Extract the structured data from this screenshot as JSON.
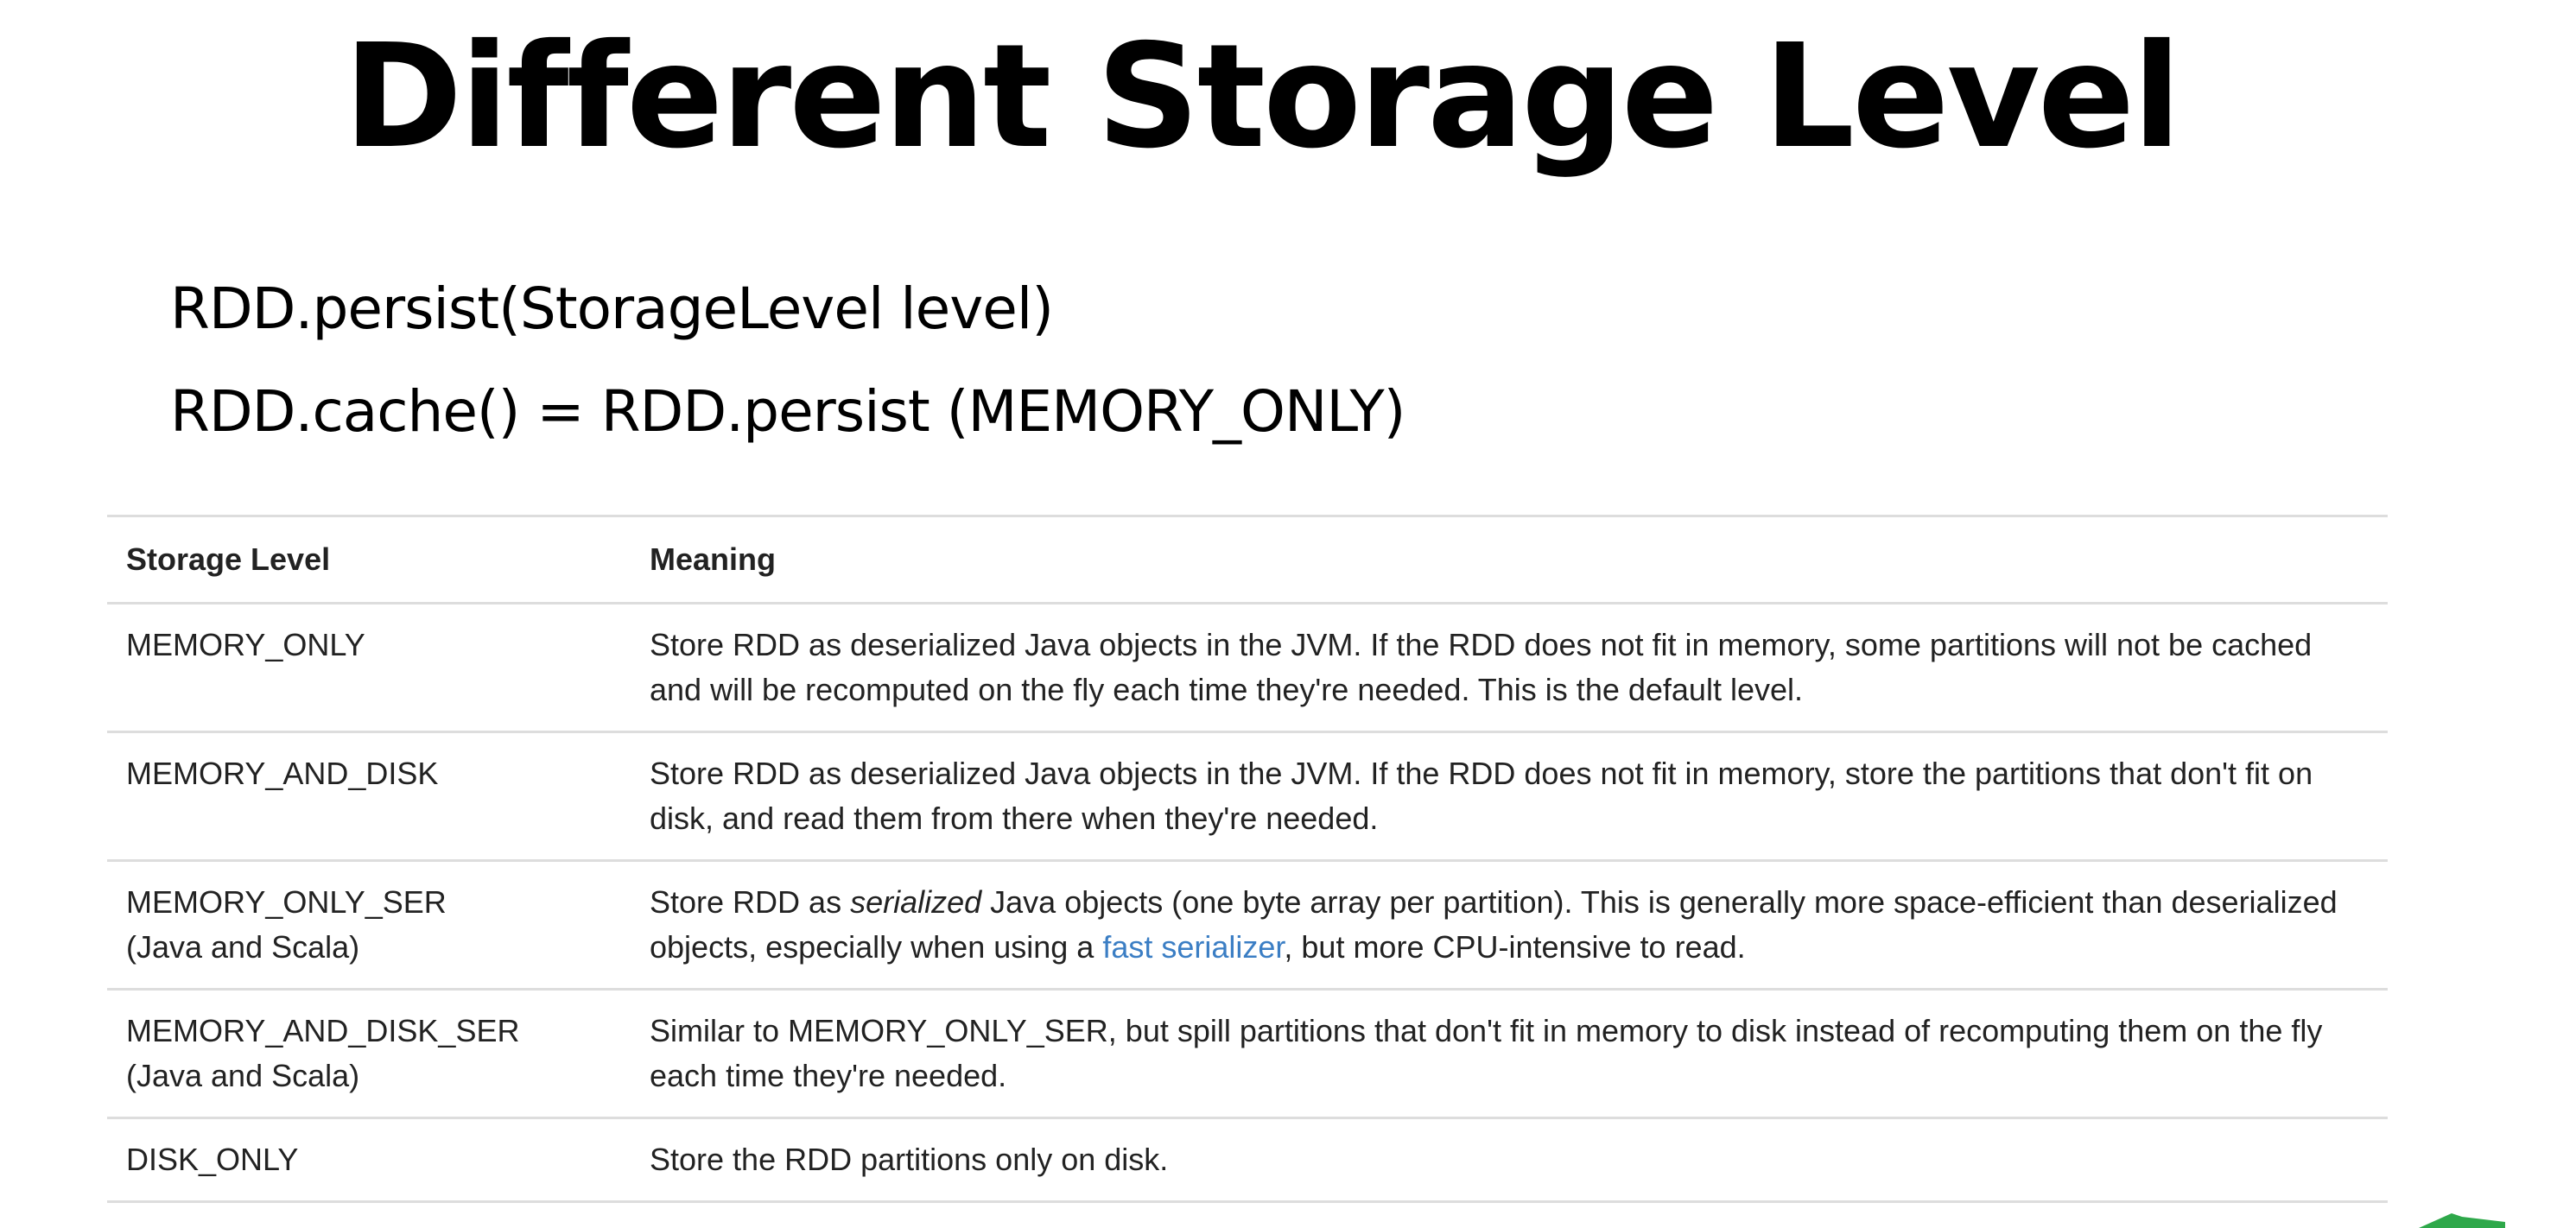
{
  "slide": {
    "title": "Different Storage Level",
    "code_lines": [
      "RDD.persist(StorageLevel level)",
      "RDD.cache() = RDD.persist (MEMORY_ONLY)"
    ]
  },
  "table": {
    "headers": [
      "Storage Level",
      "Meaning"
    ],
    "rows": [
      {
        "level": "MEMORY_ONLY",
        "meaning": "Store RDD as deserialized Java objects in the JVM. If the RDD does not fit in memory, some partitions will not be cached and will be recomputed on the fly each time they're needed. This is the default level."
      },
      {
        "level": "MEMORY_AND_DISK",
        "meaning": "Store RDD as deserialized Java objects in the JVM. If the RDD does not fit in memory, store the partitions that don't fit on disk, and read them from there when they're needed."
      },
      {
        "level": "MEMORY_ONLY_SER",
        "note": "(Java and Scala)",
        "meaning_pre": "Store RDD as ",
        "meaning_em": "serialized",
        "meaning_mid": " Java objects (one byte array per partition). This is generally more space-efficient than deserialized objects, especially when using a ",
        "meaning_link": "fast serializer",
        "meaning_post": ", but more CPU-intensive to read."
      },
      {
        "level": "MEMORY_AND_DISK_SER",
        "note": "(Java and Scala)",
        "meaning": "Similar to MEMORY_ONLY_SER, but spill partitions that don't fit in memory to disk instead of recomputing them on the fly each time they're needed."
      },
      {
        "level": "DISK_ONLY",
        "meaning": "Store the RDD partitions only on disk."
      }
    ]
  },
  "colors": {
    "link": "#3b7ec4",
    "rule": "#dddddd",
    "corner_mark": "#2ea84a"
  }
}
